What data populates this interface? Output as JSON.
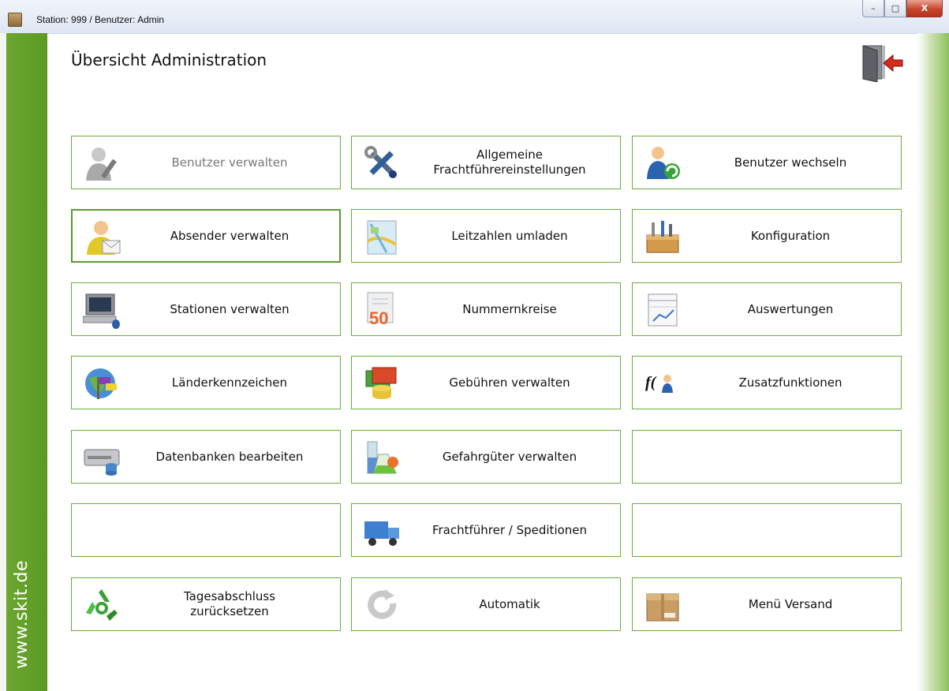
{
  "window": {
    "title": "Station: 999  /  Benutzer: Admin",
    "minimize": "–",
    "maximize": "□",
    "close": "X"
  },
  "sidebar": {
    "site": "www.skit.de"
  },
  "page": {
    "title": "Übersicht Administration"
  },
  "tiles": [
    {
      "label": "Benutzer verwalten",
      "icon": "user-pen-icon",
      "disabled": true
    },
    {
      "label": "Allgemeine\nFrachtführereinstellungen",
      "icon": "tools-icon"
    },
    {
      "label": "Benutzer wechseln",
      "icon": "user-switch-icon"
    },
    {
      "label": "Absender verwalten",
      "icon": "user-mail-icon",
      "focused": true
    },
    {
      "label": "Leitzahlen umladen",
      "icon": "map-icon"
    },
    {
      "label": "Konfiguration",
      "icon": "toolbox-icon"
    },
    {
      "label": "Stationen verwalten",
      "icon": "computer-icon"
    },
    {
      "label": "Nummernkreise",
      "icon": "number-50-icon",
      "badge": "50"
    },
    {
      "label": "Auswertungen",
      "icon": "report-icon"
    },
    {
      "label": "Länderkennzeichen",
      "icon": "globe-flag-icon"
    },
    {
      "label": "Gebühren verwalten",
      "icon": "money-icon"
    },
    {
      "label": "Zusatzfunktionen",
      "icon": "function-icon",
      "badge": "f("
    },
    {
      "label": "Datenbanken bearbeiten",
      "icon": "database-icon"
    },
    {
      "label": "Gefahrgüter verwalten",
      "icon": "chemicals-icon"
    },
    {
      "label": "",
      "icon": ""
    },
    {
      "label": "",
      "icon": ""
    },
    {
      "label": "Frachtführer / Speditionen",
      "icon": "truck-icon"
    },
    {
      "label": "",
      "icon": ""
    },
    {
      "label": "Tagesabschluss\nzurücksetzen",
      "icon": "recycle-icon"
    },
    {
      "label": "Automatik",
      "icon": "refresh-icon"
    },
    {
      "label": "Menü Versand",
      "icon": "package-icon"
    }
  ]
}
